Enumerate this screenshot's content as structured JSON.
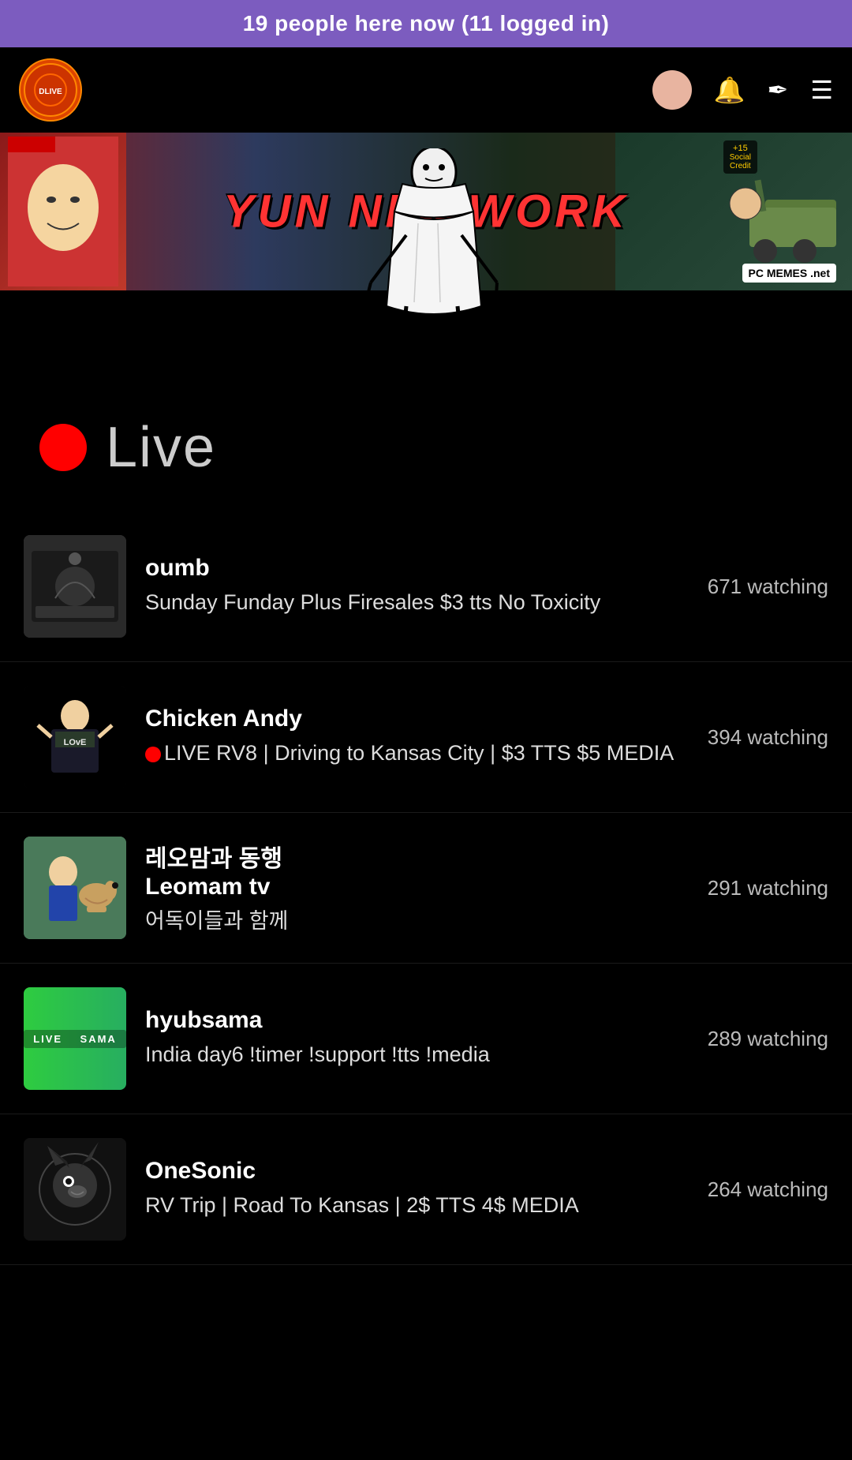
{
  "banner": {
    "text": "19 people here now (11 logged in)"
  },
  "header": {
    "logo_alt": "site logo"
  },
  "channel_banner": {
    "title_part1": "YUN NE",
    "title_part2": "WORK",
    "social_credit_label": "+15 Social Credit",
    "pc_badge": "PC MEMES .net"
  },
  "live_section": {
    "live_label": "Live"
  },
  "streams": [
    {
      "id": "oumb",
      "name": "oumb",
      "description": "Sunday Funday Plus Firesales $3 tts No Toxicity",
      "watchers": "671 watching",
      "thumb_type": "oumb"
    },
    {
      "id": "chicken-andy",
      "name": "Chicken Andy",
      "description": "🔴LIVE RV8 | Driving to Kansas City | $3 TTS $5 MEDIA",
      "watchers": "394 watching",
      "thumb_type": "chicken",
      "thumb_text": "LOvE"
    },
    {
      "id": "leomam",
      "name": "레오맘과 동행\nLeomam tv",
      "name_line1": "레오맘과 동행",
      "name_line2": "Leomam tv",
      "description": "어독이들과 함께",
      "watchers": "291 watching",
      "thumb_type": "leomam"
    },
    {
      "id": "hyubsama",
      "name": "hyubsama",
      "description": "India day6 !timer !support !tts !media",
      "watchers": "289 watching",
      "thumb_type": "hyubsama",
      "thumb_text": "LIVE    SAMA"
    },
    {
      "id": "onesonic",
      "name": "OneSonic",
      "description": "RV Trip | Road To Kansas | 2$ TTS 4$ MEDIA",
      "watchers": "264 watching",
      "thumb_type": "onesonic"
    }
  ]
}
